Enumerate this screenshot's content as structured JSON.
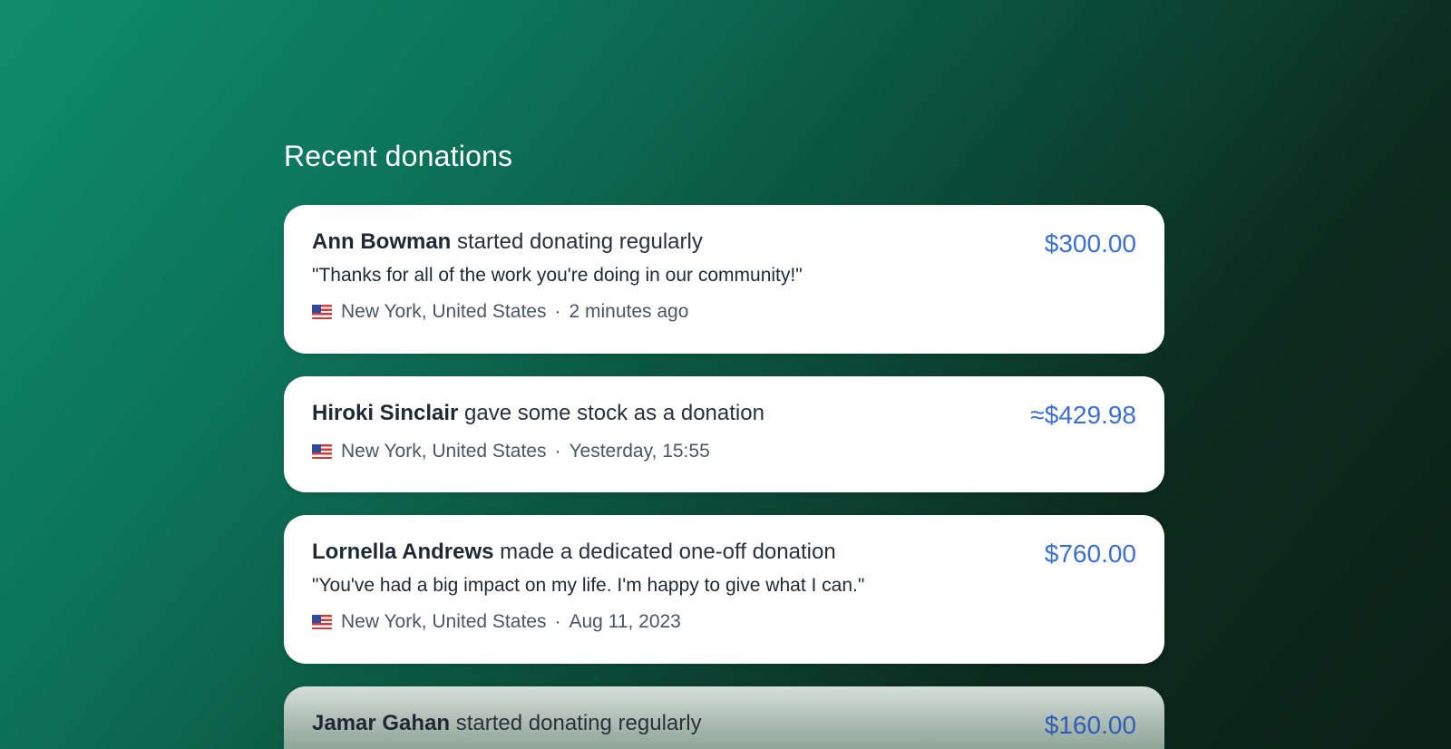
{
  "section": {
    "title": "Recent donations"
  },
  "donations": [
    {
      "donor": "Ann Bowman",
      "action": " started donating regularly",
      "amount": "$300.00",
      "message": "\"Thanks for all of the work you're doing in our community!\"",
      "location": "New York, United States",
      "separator": "·",
      "time": "2 minutes ago",
      "flag_icon": "us-flag-icon"
    },
    {
      "donor": "Hiroki Sinclair",
      "action": " gave some stock as a donation",
      "amount": "≈$429.98",
      "location": "New York, United States",
      "separator": "·",
      "time": "Yesterday, 15:55",
      "flag_icon": "us-flag-icon"
    },
    {
      "donor": "Lornella Andrews",
      "action": " made a dedicated one-off donation",
      "amount": "$760.00",
      "message": "\"You've had a big impact on my life. I'm happy to give what I can.\"",
      "location": "New York, United States",
      "separator": "·",
      "time": "Aug 11, 2023",
      "flag_icon": "us-flag-icon"
    },
    {
      "donor": "Jamar Gahan",
      "action": " started donating regularly",
      "amount": "$160.00"
    }
  ],
  "colors": {
    "amount": "#3a6fd8",
    "background_start": "#0f8c6e",
    "background_end": "#0b2118"
  }
}
